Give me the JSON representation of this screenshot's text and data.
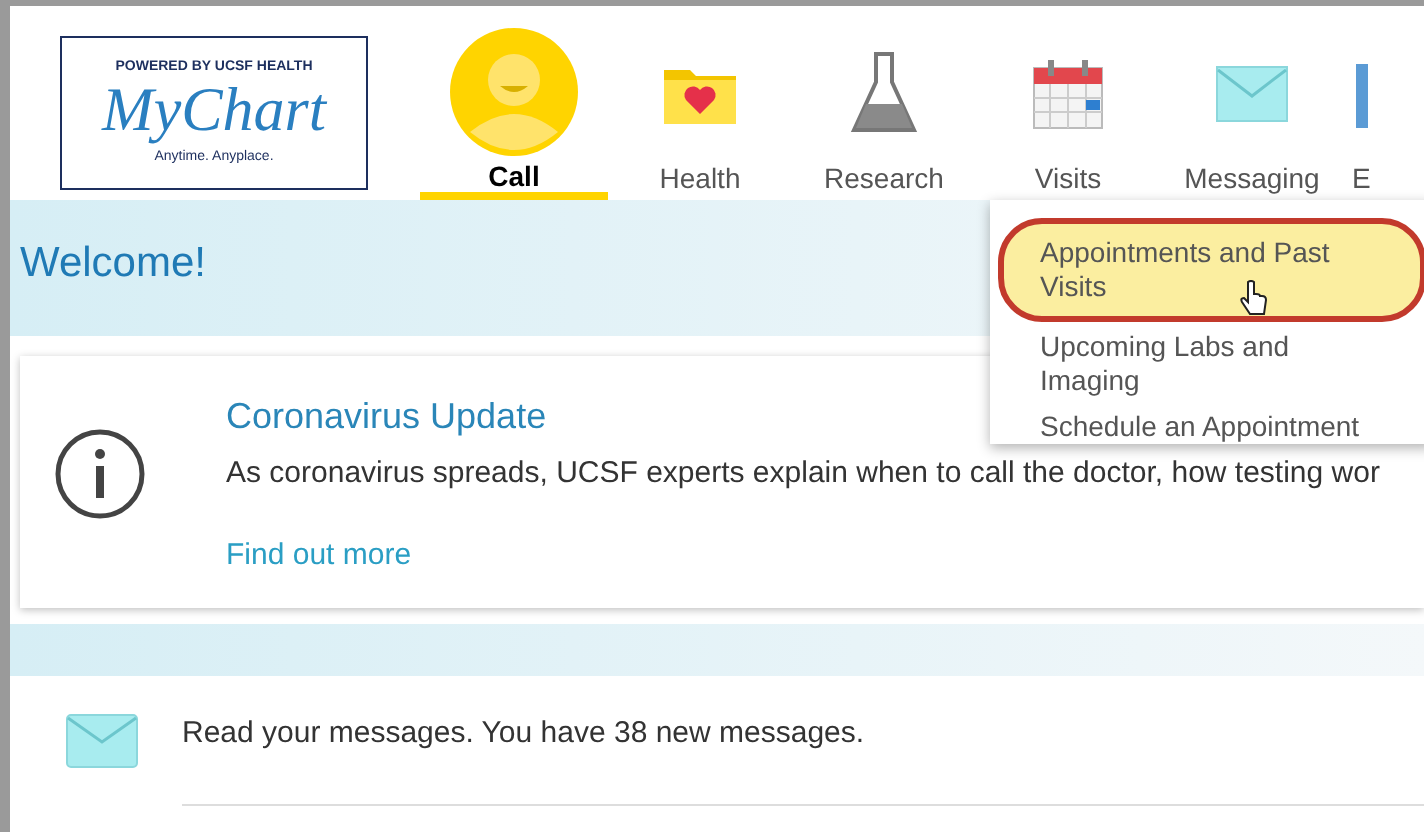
{
  "logo": {
    "tagline_top": "POWERED BY UCSF HEALTH",
    "name": "MyChart",
    "tagline_bottom": "Anytime. Anyplace."
  },
  "nav": [
    {
      "label": "Call",
      "kind": "person",
      "selected": true
    },
    {
      "label": "Health",
      "kind": "folder",
      "selected": false
    },
    {
      "label": "Research",
      "kind": "flask",
      "selected": false
    },
    {
      "label": "Visits",
      "kind": "calendar",
      "selected": false
    },
    {
      "label": "Messaging",
      "kind": "envelope",
      "selected": false
    },
    {
      "label": "E",
      "kind": "partial",
      "selected": false
    }
  ],
  "welcome": "Welcome!",
  "alert": {
    "title": "Coronavirus Update",
    "text": "As coronavirus spreads, UCSF experts explain when to call the doctor, how testing wor",
    "link": "Find out more"
  },
  "visits_menu": [
    {
      "label": "Appointments and Past Visits",
      "selected": true
    },
    {
      "label": "Upcoming Labs and Imaging",
      "selected": false
    },
    {
      "label": "Schedule an Appointment",
      "selected": false
    }
  ],
  "messages": {
    "text": "Read your messages. You have 38 new messages."
  }
}
